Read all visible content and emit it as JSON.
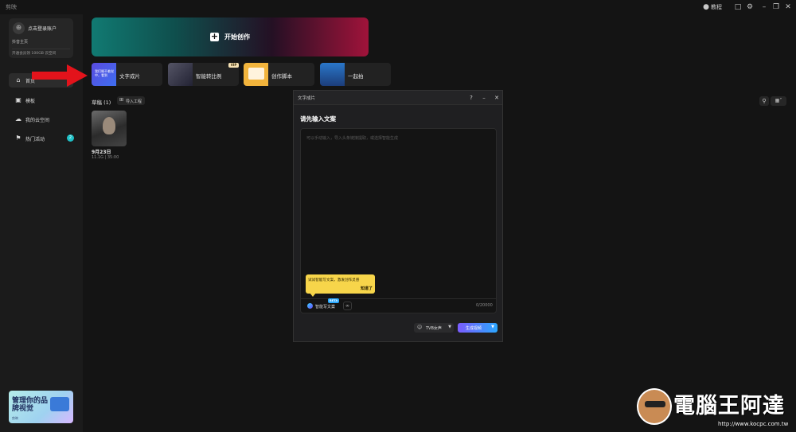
{
  "titlebar": {
    "app_name": "剪映",
    "tutorial": "教程"
  },
  "sidebar": {
    "login_name": "点击登录账户",
    "douyin_link": "抖音主页",
    "storage_text": "开通会员领 100GB 云空间",
    "nav_items": [
      {
        "label": "首页",
        "icon": "home-icon"
      },
      {
        "label": "模板",
        "icon": "template-icon"
      },
      {
        "label": "我的云空间",
        "icon": "cloud-icon"
      },
      {
        "label": "热门活动",
        "icon": "flag-icon",
        "badge": "2"
      }
    ],
    "promo": {
      "title": "管理你的品牌视觉",
      "sub": "剪映"
    }
  },
  "main": {
    "start_label": "开始创作",
    "tools": [
      {
        "label": "文字成片",
        "thumb_text": "我们睡不着觉中，看到"
      },
      {
        "label": "智能转比例",
        "badge": "VIP"
      },
      {
        "label": "创作脚本"
      },
      {
        "label": "一起拍"
      }
    ],
    "drafts_title": "草稿 (1)",
    "import_label": "导入工程",
    "draft": {
      "date": "9月23日",
      "meta": "11.1G | 35:00"
    }
  },
  "dialog": {
    "title": "文字成片",
    "heading": "请先输入文案",
    "placeholder": "可以手动输入，导入头条链接提取，或选择智能生成",
    "smart_write": "智能写文案",
    "beta": "BETA",
    "counter": "0/20000",
    "tooltip_text": "试试智能写文案，激发创作灵感",
    "tooltip_ok": "知道了",
    "voice_label": "TVB女声",
    "generate_label": "生成视频"
  },
  "watermark": {
    "title": "電腦王阿達",
    "url": "http://www.kocpc.com.tw"
  }
}
